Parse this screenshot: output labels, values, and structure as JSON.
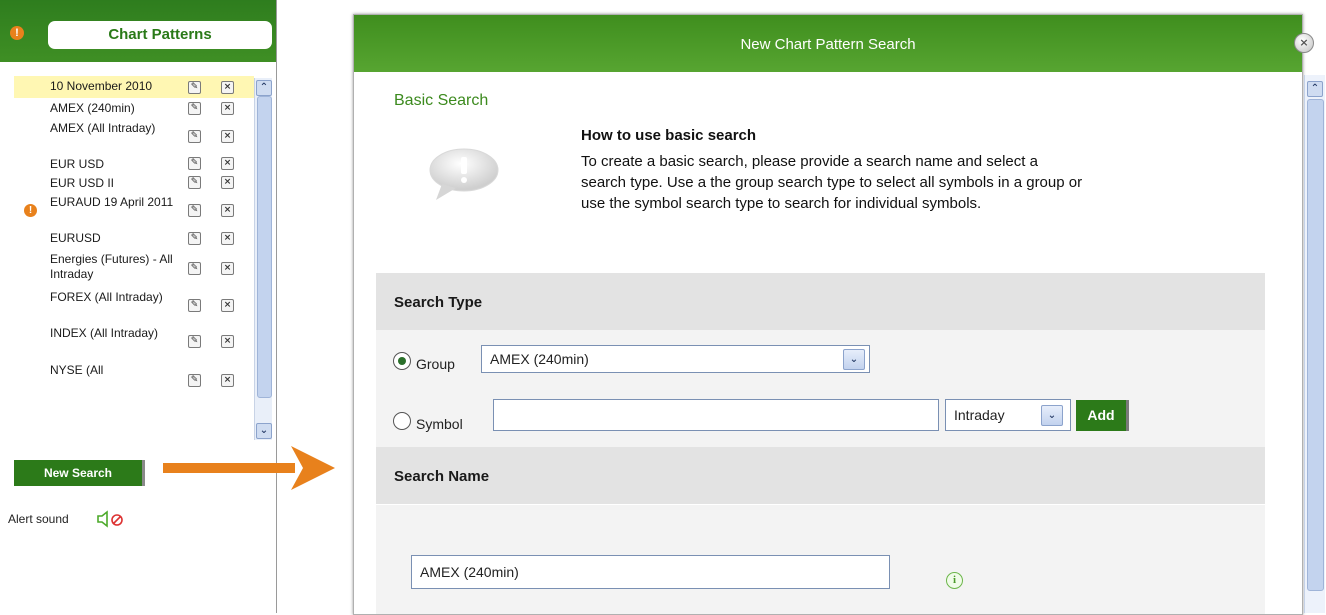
{
  "left_panel": {
    "title": "Chart Patterns",
    "header_alert": "!",
    "items": [
      {
        "label": "10 November 2010",
        "selected": true,
        "alert": false
      },
      {
        "label": "AMEX (240min)",
        "alert": false
      },
      {
        "label": "AMEX (All Intraday)",
        "alert": false
      },
      {
        "label": "EUR USD",
        "alert": false
      },
      {
        "label": "EUR USD II",
        "alert": false
      },
      {
        "label": "EURAUD 19 April 2011",
        "alert": true
      },
      {
        "label": "EURUSD",
        "alert": false
      },
      {
        "label": "Energies (Futures) - All Intraday",
        "alert": false
      },
      {
        "label": "FOREX (All Intraday)",
        "alert": false
      },
      {
        "label": "INDEX (All Intraday)",
        "alert": false
      },
      {
        "label": "NYSE (All",
        "alert": false
      }
    ],
    "edit_icon": "pencil-icon",
    "delete_icon": "x-icon",
    "new_search_label": "New Search",
    "alert_sound_label": "Alert sound",
    "alert_sound_state": "muted"
  },
  "dialog": {
    "title": "New Chart Pattern Search",
    "close_icon": "close-icon",
    "basic_search_label": "Basic Search",
    "howto_title": "How to use basic search",
    "howto_line1": "To create a basic search, please provide a search name and select a",
    "howto_line2": "search type. Use a the group search type to select all symbols in a group or",
    "howto_line3": "use the symbol search type to search for individual symbols.",
    "search_type_header": "Search Type",
    "group_label": "Group",
    "group_value": "AMEX (240min)",
    "group_selected": true,
    "symbol_label": "Symbol",
    "symbol_value": "",
    "interval_value": "Intraday",
    "add_label": "Add",
    "search_name_header": "Search Name",
    "search_name_value": "AMEX (240min)"
  },
  "colors": {
    "brand_green": "#2c7a19",
    "accent_orange": "#e8811c",
    "selected_row": "#fff7b3"
  }
}
